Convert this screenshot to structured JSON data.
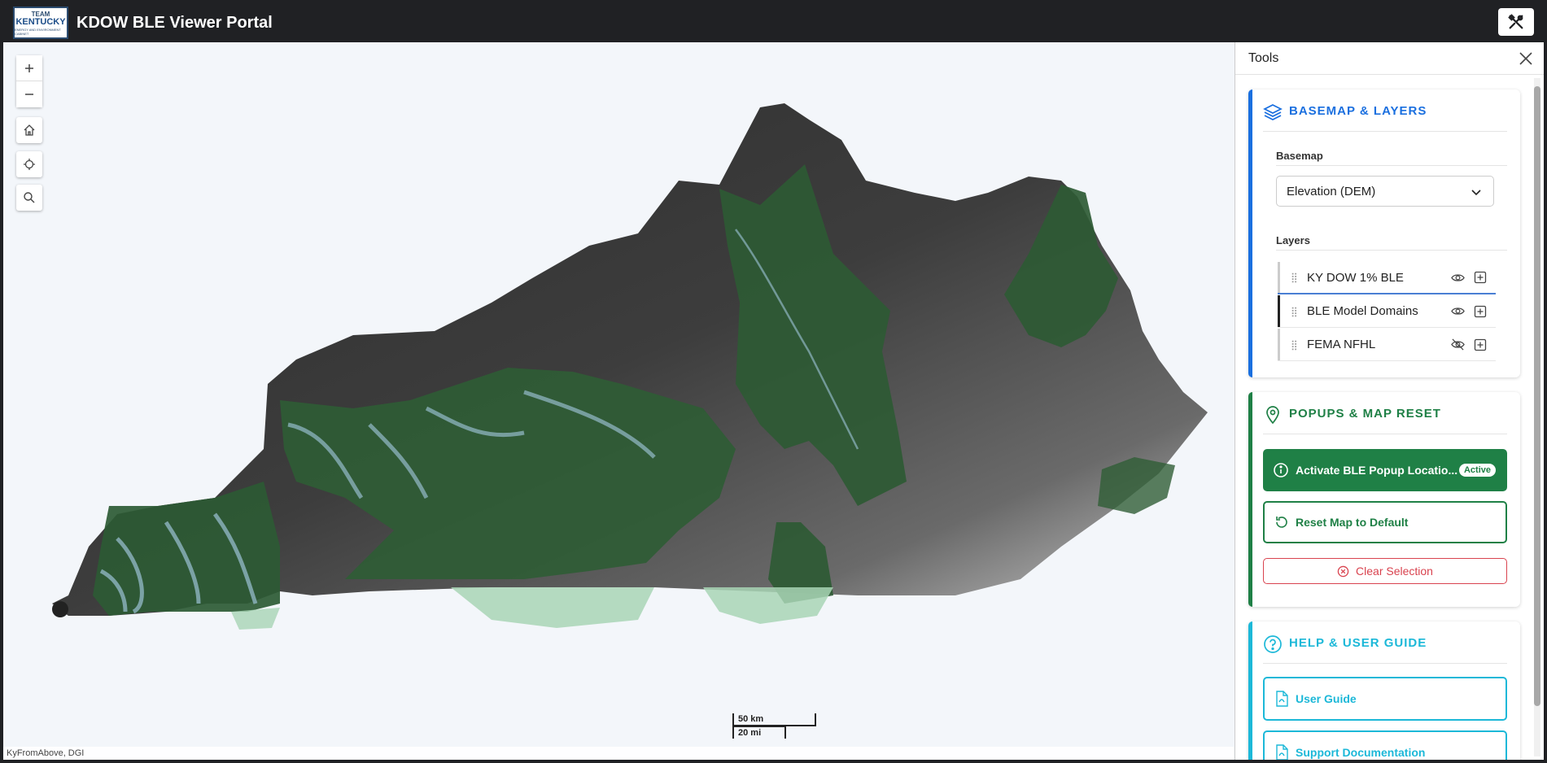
{
  "header": {
    "logo_line1": "TEAM",
    "logo_line2": "KENTUCKY",
    "logo_line3": "ENERGY AND ENVIRONMENT CABINET",
    "title": "KDOW BLE Viewer Portal"
  },
  "map": {
    "scale_km": "50 km",
    "scale_mi": "20 mi",
    "attribution": "KyFromAbove, DGI"
  },
  "panel": {
    "title": "Tools",
    "basemap_section": {
      "title": "BASEMAP & LAYERS",
      "basemap_label": "Basemap",
      "basemap_value": "Elevation (DEM)",
      "layers_label": "Layers",
      "layers": [
        {
          "name": "KY DOW 1% BLE",
          "visible": true
        },
        {
          "name": "BLE Model Domains",
          "visible": true
        },
        {
          "name": "FEMA NFHL",
          "visible": false
        }
      ]
    },
    "popup_section": {
      "title": "POPUPS & MAP RESET",
      "activate_label": "Activate BLE Popup Locatio...",
      "active_badge": "Active",
      "reset_label": "Reset Map to Default",
      "clear_label": "Clear Selection"
    },
    "help_section": {
      "title": "HELP & USER GUIDE",
      "user_guide_label": "User Guide",
      "support_label": "Support Documentation"
    }
  },
  "colors": {
    "header_bg": "#202124",
    "blue_accent": "#1a6fdf",
    "green_accent": "#1f8046",
    "cyan_accent": "#1cb8d8",
    "red_accent": "#d9434f"
  }
}
